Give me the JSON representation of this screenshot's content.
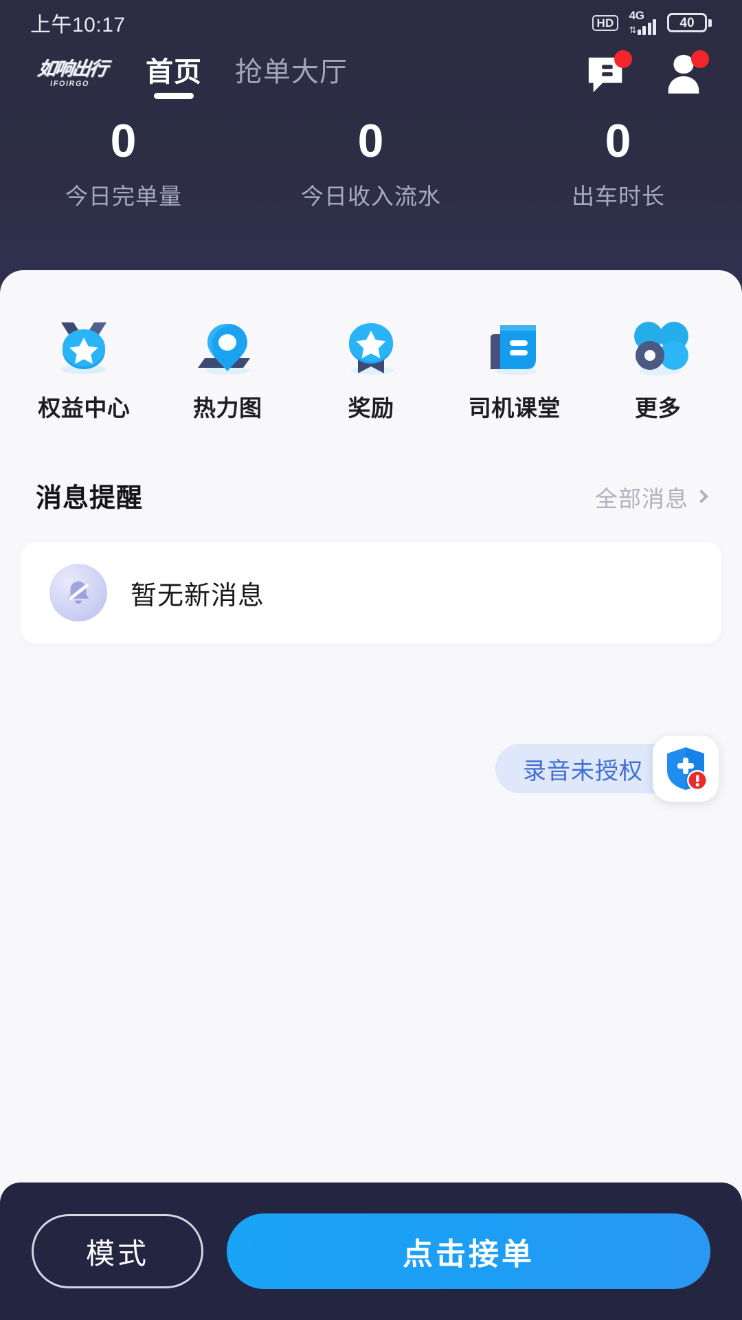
{
  "statusbar": {
    "time": "上午10:17",
    "hd": "HD",
    "network": "4G",
    "battery": "40"
  },
  "nav": {
    "logo_main": "如响出行",
    "logo_sub": "IFOIRGO",
    "tabs": [
      {
        "label": "首页",
        "active": true
      },
      {
        "label": "抢单大厅",
        "active": false
      }
    ],
    "message_icon": "chat-bubble-icon",
    "profile_icon": "user-avatar-icon"
  },
  "stats": [
    {
      "value": "0",
      "label": "今日完单量"
    },
    {
      "value": "0",
      "label": "今日收入流水"
    },
    {
      "value": "0",
      "label": "出车时长"
    }
  ],
  "quick_actions": [
    {
      "label": "权益中心",
      "icon": "medal-star-icon"
    },
    {
      "label": "热力图",
      "icon": "map-pin-icon"
    },
    {
      "label": "奖励",
      "icon": "award-badge-icon"
    },
    {
      "label": "司机课堂",
      "icon": "book-icon"
    },
    {
      "label": "更多",
      "icon": "more-grid-icon"
    }
  ],
  "messages": {
    "section_title": "消息提醒",
    "more_label": "全部消息",
    "empty_text": "暂无新消息",
    "empty_icon": "bell-off-icon"
  },
  "permission": {
    "pill_label": "录音未授权",
    "badge_icon": "shield-alert-icon"
  },
  "bottombar": {
    "mode_label": "模式",
    "accept_label": "点击接单"
  },
  "colors": {
    "header_bg": "#2c2d44",
    "sheet_bg": "#f8f8fb",
    "accent_blue": "#1c9ef5",
    "badge_red": "#f5262b",
    "pill_bg": "#dfe7fb",
    "pill_text": "#3f6fd0",
    "bottombar_bg": "#242540"
  }
}
